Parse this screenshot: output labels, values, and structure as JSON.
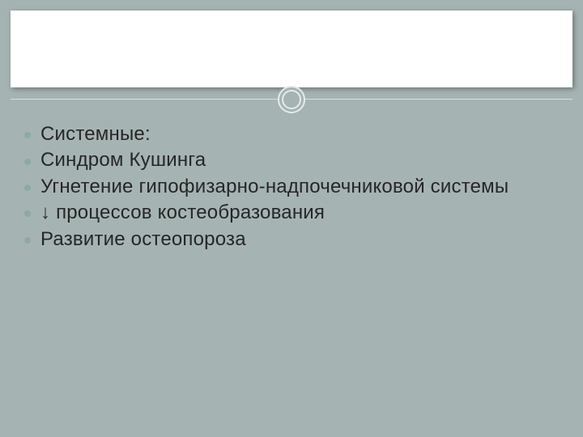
{
  "header": {
    "title": ""
  },
  "bullets": [
    "Системные:",
    "Синдром Кушинга",
    "Угнетение гипофизарно-надпочечниковой системы",
    "↓ процессов костеобразования",
    "Развитие остеопороза"
  ]
}
